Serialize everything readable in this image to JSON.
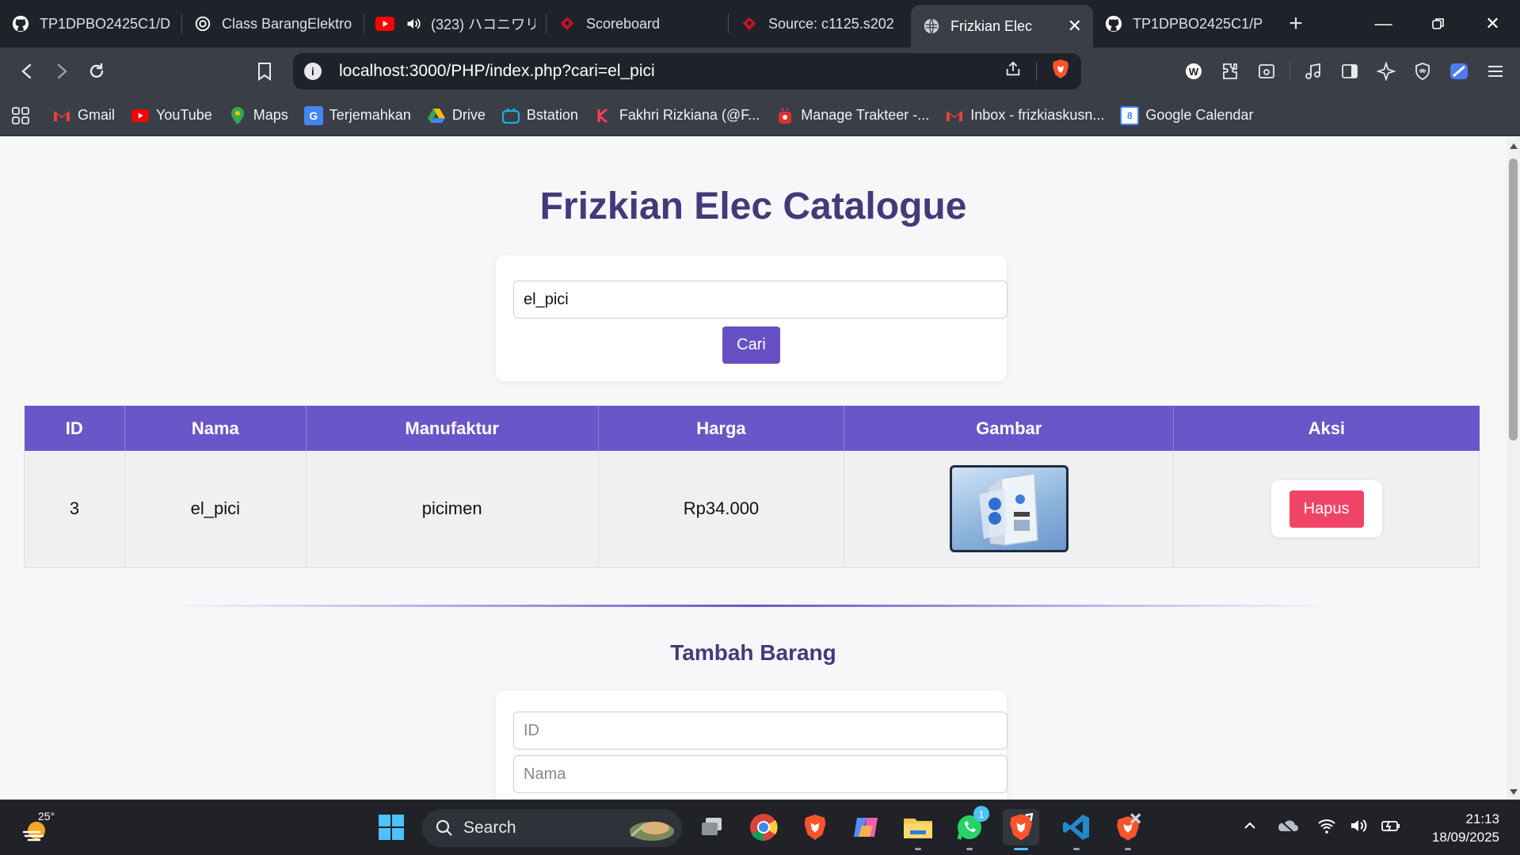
{
  "browser": {
    "tabs": [
      {
        "label": "TP1DPBO2425C1/D",
        "icon": "github-icon",
        "active": false
      },
      {
        "label": "Class BarangElektro",
        "icon": "chatgpt-icon",
        "active": false
      },
      {
        "label": "(323) ハコニワリリ",
        "icon": "youtube-icon",
        "active": false
      },
      {
        "label": "Scoreboard",
        "icon": "ctf-icon",
        "active": false
      },
      {
        "label": "Source: c1125.s202",
        "icon": "ctf-icon",
        "active": false
      },
      {
        "label": "Frizkian Elec",
        "icon": "globe-icon",
        "active": true
      },
      {
        "label": "TP1DPBO2425C1/P",
        "icon": "github-icon",
        "active": false
      }
    ],
    "url": "localhost:3000/PHP/index.php?cari=el_pici",
    "bookmarks": [
      {
        "label": "Gmail",
        "icon": "gmail-icon"
      },
      {
        "label": "YouTube",
        "icon": "youtube-icon"
      },
      {
        "label": "Maps",
        "icon": "maps-icon"
      },
      {
        "label": "Terjemahkan",
        "icon": "translate-icon"
      },
      {
        "label": "Drive",
        "icon": "drive-icon"
      },
      {
        "label": "Bstation",
        "icon": "bstation-icon"
      },
      {
        "label": "Fakhri Rizkiana (@F...",
        "icon": "kofi-icon"
      },
      {
        "label": "Manage Trakteer -...",
        "icon": "trakteer-icon"
      },
      {
        "label": "Inbox - frizkiaskusn...",
        "icon": "gmail-icon"
      },
      {
        "label": "Google Calendar",
        "icon": "calendar-icon"
      }
    ]
  },
  "page": {
    "title": "Frizkian Elec Catalogue",
    "search": {
      "value": "el_pici",
      "button_label": "Cari"
    },
    "table": {
      "headers": [
        "ID",
        "Nama",
        "Manufaktur",
        "Harga",
        "Gambar",
        "Aksi"
      ],
      "rows": [
        {
          "id": "3",
          "nama": "el_pici",
          "manufaktur": "picimen",
          "harga": "Rp34.000",
          "gambar": "pc-case-image",
          "aksi": "Hapus"
        }
      ]
    },
    "add_section": {
      "title": "Tambah Barang",
      "fields": [
        {
          "placeholder": "ID"
        },
        {
          "placeholder": "Nama"
        }
      ]
    }
  },
  "taskbar": {
    "weather_temp": "25°",
    "search_label": "Search",
    "whatsapp_badge": "1",
    "time": "21:13",
    "date": "18/09/2025"
  },
  "colors": {
    "accent": "#6a56c8",
    "title": "#433a7a",
    "danger": "#f04466"
  }
}
